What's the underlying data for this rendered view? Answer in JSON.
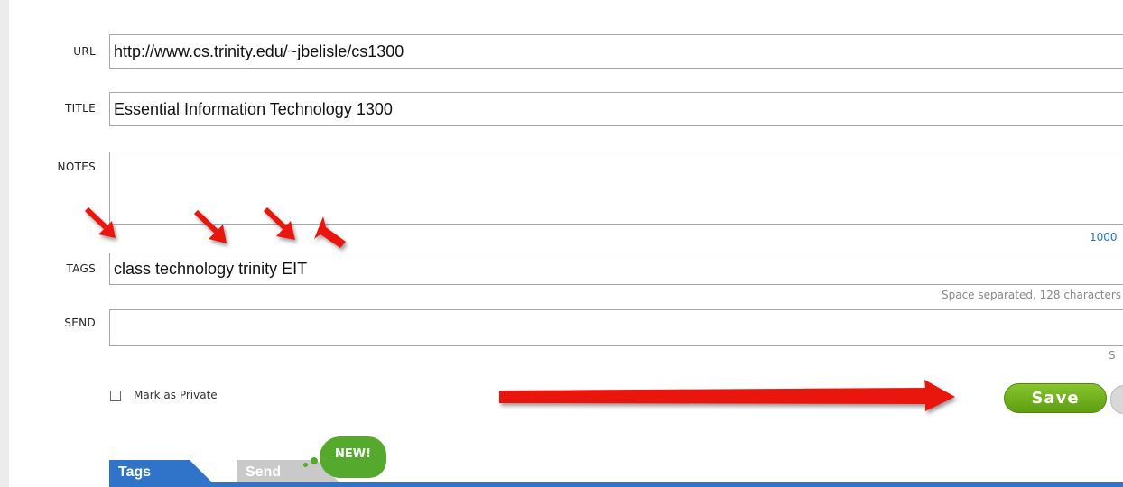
{
  "form": {
    "url_label": "URL",
    "url_value": "http://www.cs.trinity.edu/~jbelisle/cs1300",
    "title_label": "TITLE",
    "title_value": "Essential Information Technology 1300",
    "notes_label": "NOTES",
    "notes_value": "",
    "notes_counter": "1000",
    "tags_label": "TAGS",
    "tags_value": "class technology trinity EIT",
    "tags_hint": "Space separated, 128 characters",
    "send_label": "SEND",
    "send_value": "",
    "send_hint": "S",
    "private_label": "Mark as Private",
    "private_checked": false,
    "save_label": "Save"
  },
  "tabs": [
    {
      "label": "Tags",
      "active": true
    },
    {
      "label": "Send",
      "active": false
    }
  ],
  "new_badge": "NEW!",
  "colors": {
    "annotation_arrow": "#e8140f",
    "save_button": "#6cab1c",
    "tab_active": "#2f74c9",
    "tab_inactive": "#c9c9c9",
    "new_badge": "#55aa2e",
    "counter_text": "#2a6fc7"
  }
}
